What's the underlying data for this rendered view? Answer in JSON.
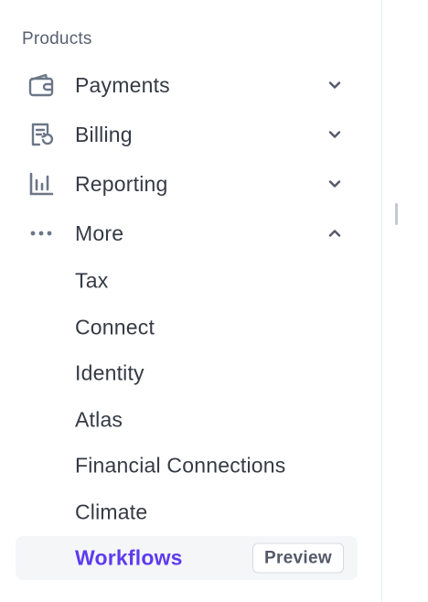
{
  "sidebar": {
    "section_title": "Products",
    "items": [
      {
        "label": "Payments",
        "icon": "wallet-icon",
        "expanded": false
      },
      {
        "label": "Billing",
        "icon": "billing-icon",
        "expanded": false
      },
      {
        "label": "Reporting",
        "icon": "bar-chart-icon",
        "expanded": false
      },
      {
        "label": "More",
        "icon": "more-dots-icon",
        "expanded": true
      }
    ],
    "more_items": [
      {
        "label": "Tax"
      },
      {
        "label": "Connect"
      },
      {
        "label": "Identity"
      },
      {
        "label": "Atlas"
      },
      {
        "label": "Financial Connections"
      },
      {
        "label": "Climate"
      },
      {
        "label": "Workflows",
        "active": true,
        "badge": "Preview"
      }
    ]
  },
  "colors": {
    "text": "#353a44",
    "muted": "#596171",
    "accent": "#5e3bee",
    "active_bg": "#f5f6f8",
    "border": "#ebeef1"
  }
}
